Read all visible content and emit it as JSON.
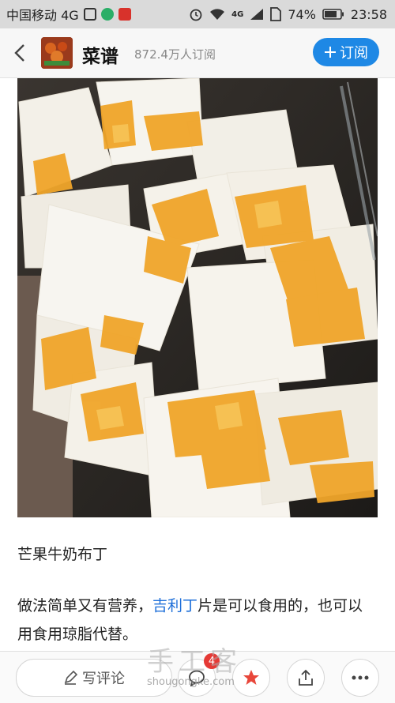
{
  "status_bar": {
    "carrier": "中国移动 4G",
    "battery": "74%",
    "time": "23:58",
    "network_badge": "4G"
  },
  "header": {
    "title": "菜谱",
    "subscribers": "872.4万人订阅",
    "subscribe_label": "订阅",
    "accent_color": "#1e88e5"
  },
  "article": {
    "title": "芒果牛奶布丁",
    "body_prefix": "做法简单又有营养，",
    "body_link": "吉利丁",
    "body_suffix": "片是可以食用的，也可以用食用琼脂代替。"
  },
  "bottom_bar": {
    "comment_placeholder": "写评论",
    "comment_count": "4",
    "icons": [
      "pen-icon",
      "comment-icon",
      "star-icon",
      "share-icon",
      "more-icon"
    ]
  },
  "watermark": {
    "text": "手工客",
    "url": "shougongke.com"
  }
}
